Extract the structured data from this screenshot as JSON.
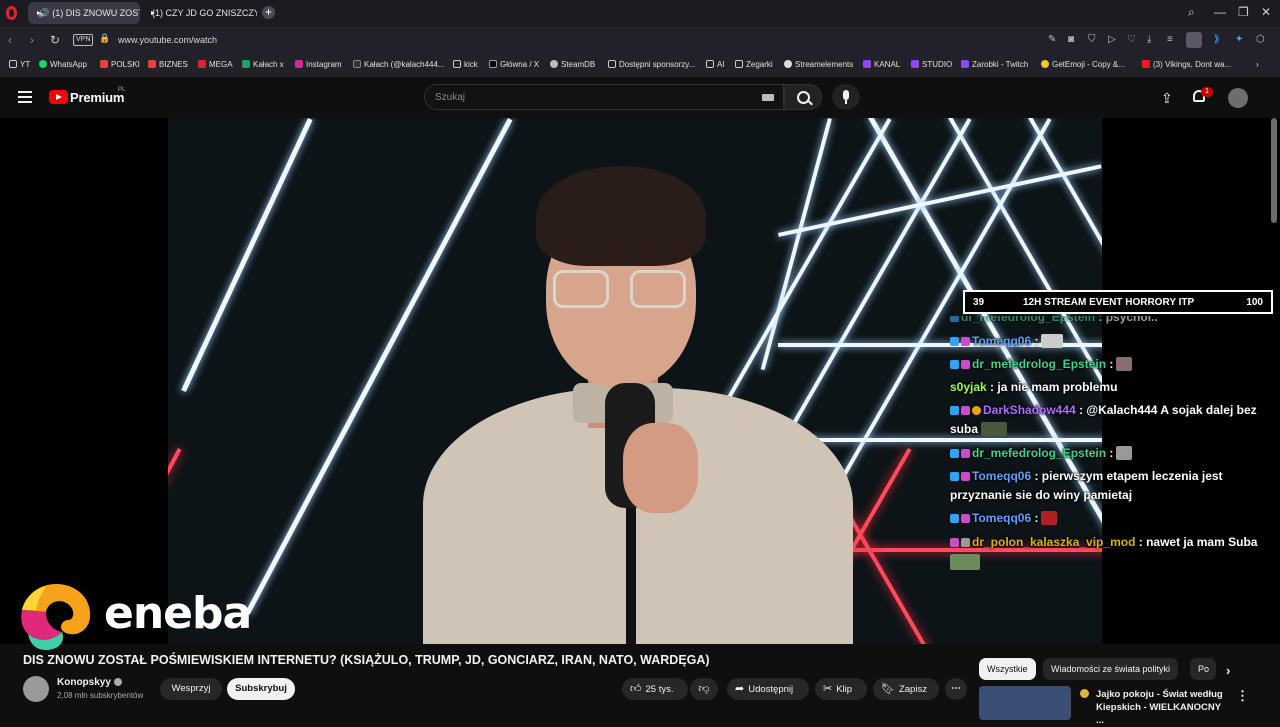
{
  "browser": {
    "tabs": [
      {
        "label": "(1) DIS ZNOWU ZOST…"
      },
      {
        "label": "(1) CZY JD GO ZNISZCZY…"
      }
    ],
    "address": "www.youtube.com/watch",
    "vpn_label": "VPN"
  },
  "bookmarks": [
    {
      "label": "YT"
    },
    {
      "label": "WhatsApp"
    },
    {
      "label": "POLSKI"
    },
    {
      "label": "BIZNES"
    },
    {
      "label": "MEGA"
    },
    {
      "label": "Kałach x"
    },
    {
      "label": "Instagram"
    },
    {
      "label": "Kałach (@kalach444..."
    },
    {
      "label": "kick"
    },
    {
      "label": "Główna / X"
    },
    {
      "label": "SteamDB"
    },
    {
      "label": "Dostępni sponsorzy..."
    },
    {
      "label": "AI"
    },
    {
      "label": "Zegarki"
    },
    {
      "label": "Streamelements"
    },
    {
      "label": "KANAL"
    },
    {
      "label": "STUDIO"
    },
    {
      "label": "Zarobki - Twitch"
    },
    {
      "label": "GetEmoji - Copy &..."
    },
    {
      "label": "(3) Vikings, Dont wa..."
    }
  ],
  "youtube": {
    "logo_text": "Premium",
    "region": "PL",
    "search_placeholder": "Szukaj",
    "notification_count": "1"
  },
  "overlay": {
    "event_left": "39",
    "event_title": "12H STREAM EVENT HORRORY ITP",
    "event_right": "100",
    "chat": [
      {
        "user": "dr_mefedrolog_Epstein",
        "text": ": psychol.."
      },
      {
        "user": "Tomeqq06",
        "text": ":"
      },
      {
        "user": "dr_mefedrolog_Epstein",
        "text": ":"
      },
      {
        "user": "s0yjak",
        "text": ": ja nie mam problemu"
      },
      {
        "user": "DarkShadow444",
        "text": ": @Kalach444 A sojak dalej bez"
      },
      {
        "user": "",
        "text": "suba"
      },
      {
        "user": "dr_mefedrolog_Epstein",
        "text": ":"
      },
      {
        "user": "Tomeqq06",
        "text": ": pierwszym etapem leczenia jest"
      },
      {
        "user": "",
        "text": "przyznanie sie do winy pamietaj"
      },
      {
        "user": "Tomeqq06",
        "text": ":"
      },
      {
        "user": "dr_polon_kalaszka_vip_mod",
        "text": ": nawet ja mam Suba"
      }
    ],
    "sponsor": "eneba"
  },
  "video": {
    "title": "DIS ZNOWU ZOSTAŁ POŚMIEWISKIEM INTERNETU? (KSIĄŻULO, TRUMP, JD, GONCIARZ, IRAN, NATO, WARDĘGA)",
    "channel": "Konopskyy",
    "subscribers": "2,08 mln subskrybentów",
    "support_label": "Wesprzyj",
    "subscribe_label": "Subskrybuj",
    "likes": "25 tys.",
    "share_label": "Udostępnij",
    "clip_label": "Klip",
    "save_label": "Zapisz"
  },
  "sidebar": {
    "chips": [
      "Wszystkie",
      "Wiadomości ze świata polityki",
      "Po"
    ],
    "rec_title": "Jajko pokoju - Świat według Kiepskich - WIELKANOCNY ..."
  },
  "colors": {
    "yt_red": "#ff0000",
    "bg": "#0f0f0f",
    "chip_bg": "#272727"
  }
}
